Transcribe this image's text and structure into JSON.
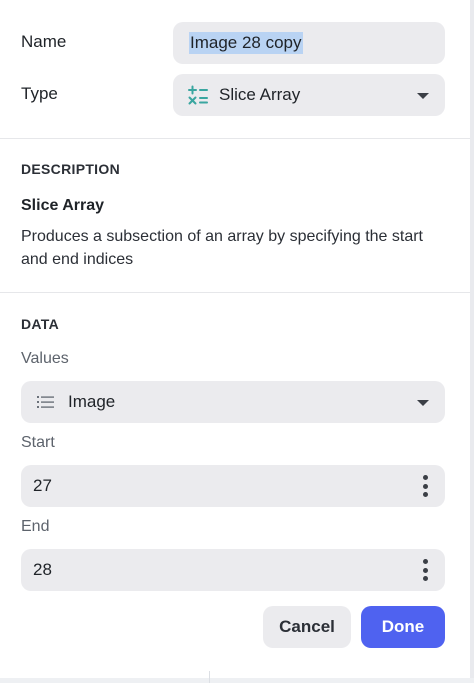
{
  "form": {
    "name_label": "Name",
    "name_value": "Image 28 copy",
    "type_label": "Type",
    "type_value": "Slice Array",
    "type_icon": "math-operators-icon"
  },
  "description": {
    "heading": "DESCRIPTION",
    "title": "Slice Array",
    "body": "Produces a subsection of an array by specifying the start and end indices"
  },
  "data": {
    "heading": "DATA",
    "values_label": "Values",
    "values_value": "Image",
    "values_icon": "list-icon",
    "start_label": "Start",
    "start_value": "27",
    "end_label": "End",
    "end_value": "28"
  },
  "actions": {
    "cancel_label": "Cancel",
    "done_label": "Done"
  },
  "colors": {
    "accent": "#4f62f0",
    "selection": "#b9d3f3",
    "field_bg": "#ebebee",
    "type_icon": "#3aa6a0"
  }
}
